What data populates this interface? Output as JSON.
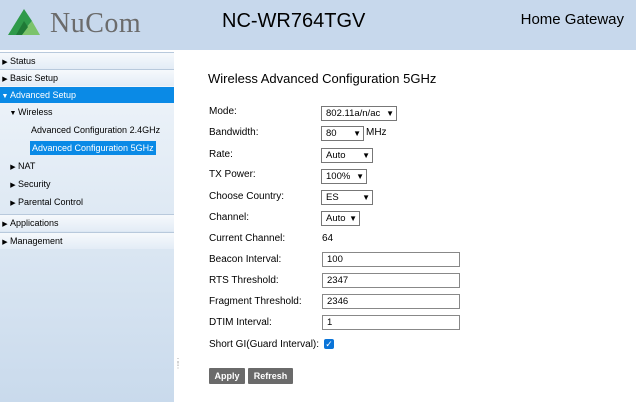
{
  "header": {
    "brand": "NuCom",
    "model": "NC-WR764TGV",
    "product": "Home Gateway"
  },
  "sidebar": {
    "status": "Status",
    "basic_setup": "Basic Setup",
    "advanced_setup": "Advanced Setup",
    "wireless": "Wireless",
    "adv_cfg_24": "Advanced Configuration 2.4GHz",
    "adv_cfg_5": "Advanced Configuration 5GHz",
    "nat": "NAT",
    "security": "Security",
    "parental_control": "Parental Control",
    "applications": "Applications",
    "management": "Management"
  },
  "form": {
    "title": "Wireless Advanced Configuration 5GHz",
    "mode": {
      "label": "Mode:",
      "value": "802.11a/n/ac"
    },
    "bandwidth": {
      "label": "Bandwidth:",
      "value": "80",
      "unit": "MHz"
    },
    "rate": {
      "label": "Rate:",
      "value": "Auto"
    },
    "tx_power": {
      "label": "TX Power:",
      "value": "100%"
    },
    "country": {
      "label": "Choose Country:",
      "value": "ES"
    },
    "channel": {
      "label": "Channel:",
      "value": "Auto"
    },
    "current_channel": {
      "label": "Current Channel:",
      "value": "64"
    },
    "beacon_interval": {
      "label": "Beacon Interval:",
      "value": "100"
    },
    "rts_threshold": {
      "label": "RTS Threshold:",
      "value": "2347"
    },
    "fragment_threshold": {
      "label": "Fragment Threshold:",
      "value": "2346"
    },
    "dtim_interval": {
      "label": "DTIM Interval:",
      "value": "1"
    },
    "short_gi": {
      "label": "Short GI(Guard Interval):",
      "checked": true
    },
    "apply_label": "Apply",
    "refresh_label": "Refresh"
  },
  "colors": {
    "header_bg": "#c7d8ec",
    "accent": "#0a8ae6",
    "button_bg": "#6a6a6a"
  }
}
